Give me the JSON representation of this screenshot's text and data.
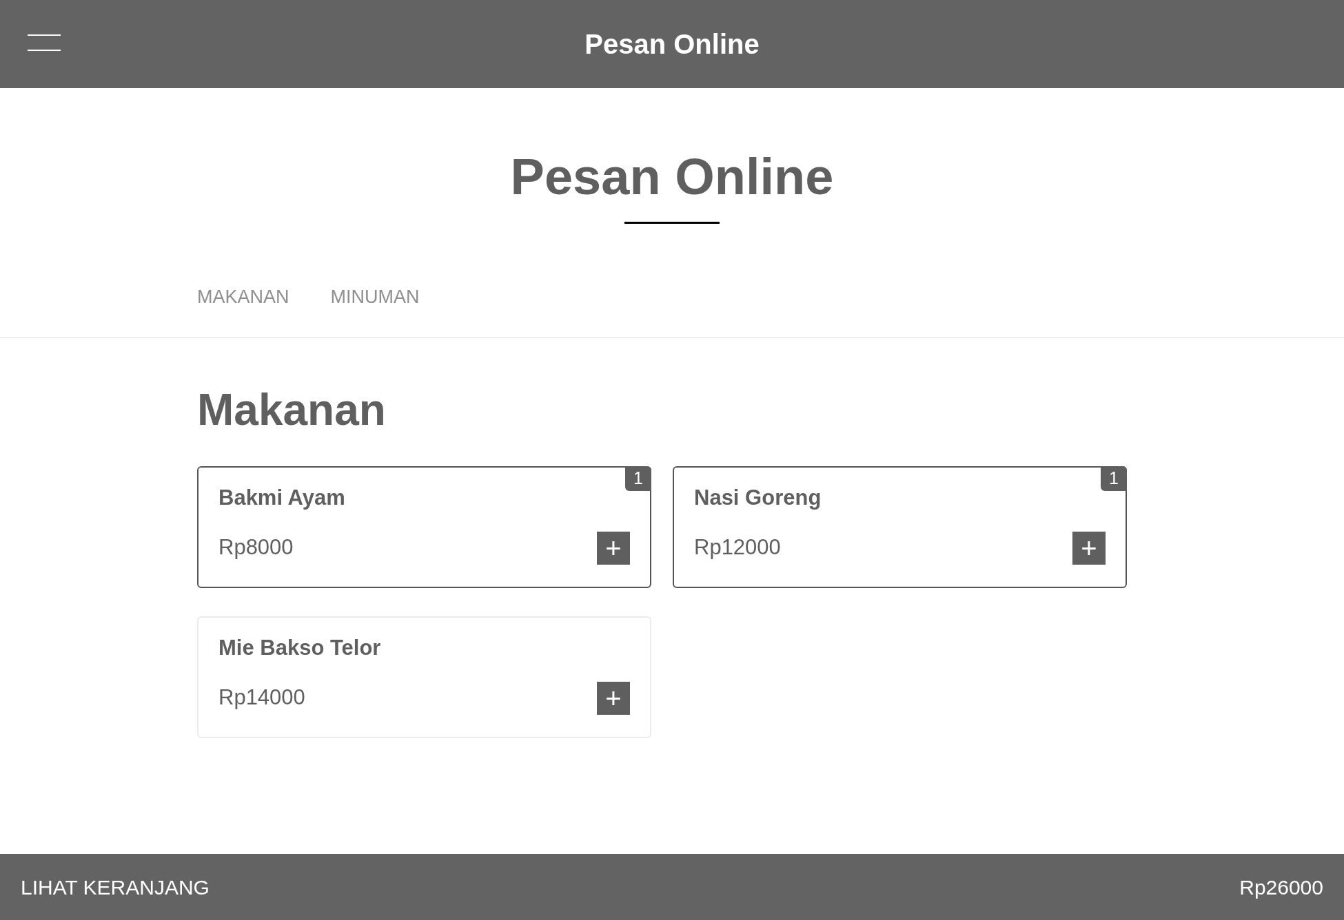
{
  "header": {
    "title": "Pesan Online"
  },
  "page_title": "Pesan Online",
  "tabs": [
    {
      "label": "MAKANAN",
      "selected": false
    },
    {
      "label": "MINUMAN",
      "selected": false
    }
  ],
  "section": {
    "title": "Makanan",
    "items": [
      {
        "name": "Bakmi Ayam",
        "price": "Rp8000",
        "selected": true,
        "quantity": "1",
        "add": "+"
      },
      {
        "name": "Nasi Goreng",
        "price": "Rp12000",
        "selected": true,
        "quantity": "1",
        "add": "+"
      },
      {
        "name": "Mie Bakso Telor",
        "price": "Rp14000",
        "selected": false,
        "add": "+"
      }
    ]
  },
  "footer": {
    "cart_label": "LIHAT KERANJANG",
    "total": "Rp26000"
  }
}
